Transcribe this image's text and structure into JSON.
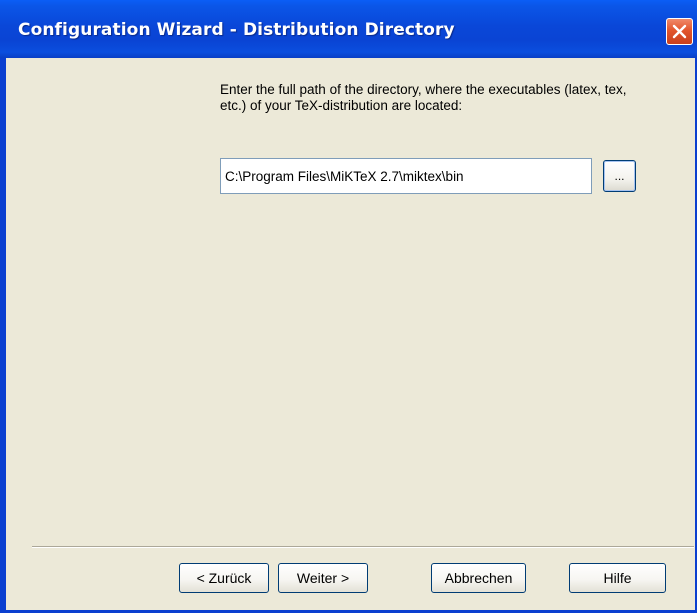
{
  "window": {
    "title": "Configuration Wizard - Distribution Directory"
  },
  "icons": {
    "close": "close-icon"
  },
  "colors": {
    "titlebar": "#0a47d8",
    "client": "#ece9d8",
    "close_button": "#e2562d"
  },
  "content": {
    "instruction": "Enter the full path of the directory, where the executables (latex, tex, etc.) of your TeX-distribution are located:",
    "path_value": "C:\\Program Files\\MiKTeX 2.7\\miktex\\bin",
    "browse_label": "..."
  },
  "buttons": {
    "back": "< Zurück",
    "next": "Weiter >",
    "cancel": "Abbrechen",
    "help": "Hilfe"
  }
}
